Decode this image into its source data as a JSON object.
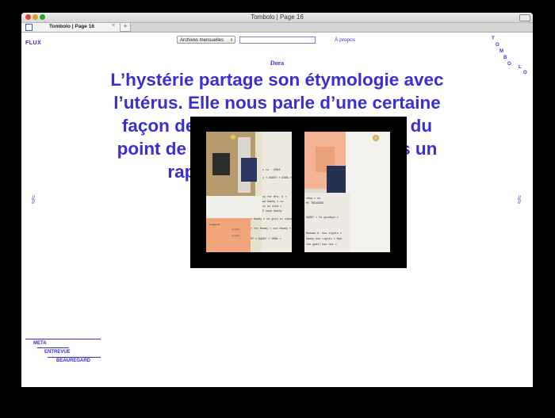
{
  "window": {
    "title": "Tombolo | Page 16"
  },
  "tabs": [
    {
      "label": "Tombolo | Page 16",
      "close": "×"
    }
  ],
  "newtab": "+",
  "nav": {
    "flux": "FLUX",
    "archive_label": "Archives mensuelles",
    "archive_arrows": "⇕",
    "apropos": "À propos"
  },
  "vertical_logo": [
    "T",
    "O",
    "M",
    "B",
    "O",
    "L",
    "O"
  ],
  "article": {
    "author": "Dora",
    "headline": "L’hystérie partage son étymologie avec l’utérus. Elle nous parle d’une certaine façon de penser le corps féminin, du point de vue le plus intérieur, dans un rapport au monde et à [...]",
    "nav_left": "//\n//",
    "nav_right": "//\n//"
  },
  "overlay": {
    "left_cards": {
      "t1": "s to · DORA",
      "t2": "y » DADDY » DORA »",
      "t3": "ny for Mrs. K »",
      "t4": "ad  Daddy » no",
      "t5": "is no dive »",
      "t6": "D have Daddy",
      "t7": "» Daddy » no gold to chase",
      "t8": "» for Mommy » not Daddy »",
      "t9": "DY » DADDY » DORA »",
      "t10": "D'appelle",
      "t11": "un rêve",
      "t12": "un rêve"
    },
    "right_cards": {
      "r1": "Madame K. has rights »",
      "r2": "Daddy has rights » Mad",
      "r3": "the gods? has has »",
      "r4": "show » no",
      "r5": "MY TREASURE",
      "r6": "DADDY » Is goodbye »"
    }
  },
  "meta_nav": {
    "meta": "META",
    "entrevue": "ENTREVUE",
    "beauregard": "BEAUREGARD"
  },
  "colors": {
    "accent": "#3a2fd0",
    "background": "#000000",
    "page": "#ffffff"
  }
}
